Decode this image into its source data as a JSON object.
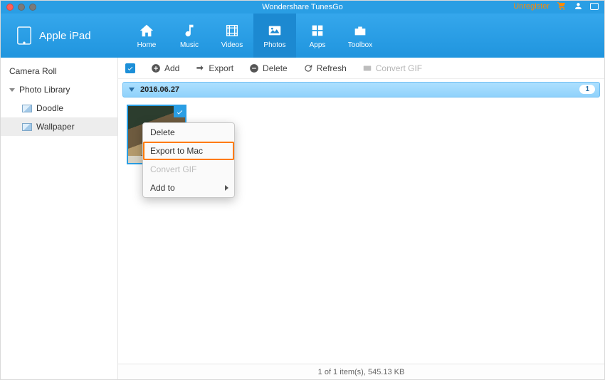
{
  "app_title": "Wondershare TunesGo",
  "header": {
    "unregister_label": "Unregister"
  },
  "device": {
    "name": "Apple iPad"
  },
  "nav": {
    "home": "Home",
    "music": "Music",
    "videos": "Videos",
    "photos": "Photos",
    "apps": "Apps",
    "toolbox": "Toolbox"
  },
  "sidebar": {
    "camera_roll": "Camera Roll",
    "photo_library": "Photo Library",
    "items": [
      {
        "label": "Doodle"
      },
      {
        "label": "Wallpaper"
      }
    ]
  },
  "toolbar": {
    "add": "Add",
    "export": "Export",
    "delete": "Delete",
    "refresh": "Refresh",
    "convert_gif": "Convert GIF"
  },
  "group": {
    "date": "2016.06.27",
    "count": "1"
  },
  "context_menu": {
    "delete": "Delete",
    "export_to_mac": "Export to Mac",
    "convert_gif": "Convert GIF",
    "add_to": "Add to"
  },
  "status": "1 of 1 item(s), 545.13 KB"
}
